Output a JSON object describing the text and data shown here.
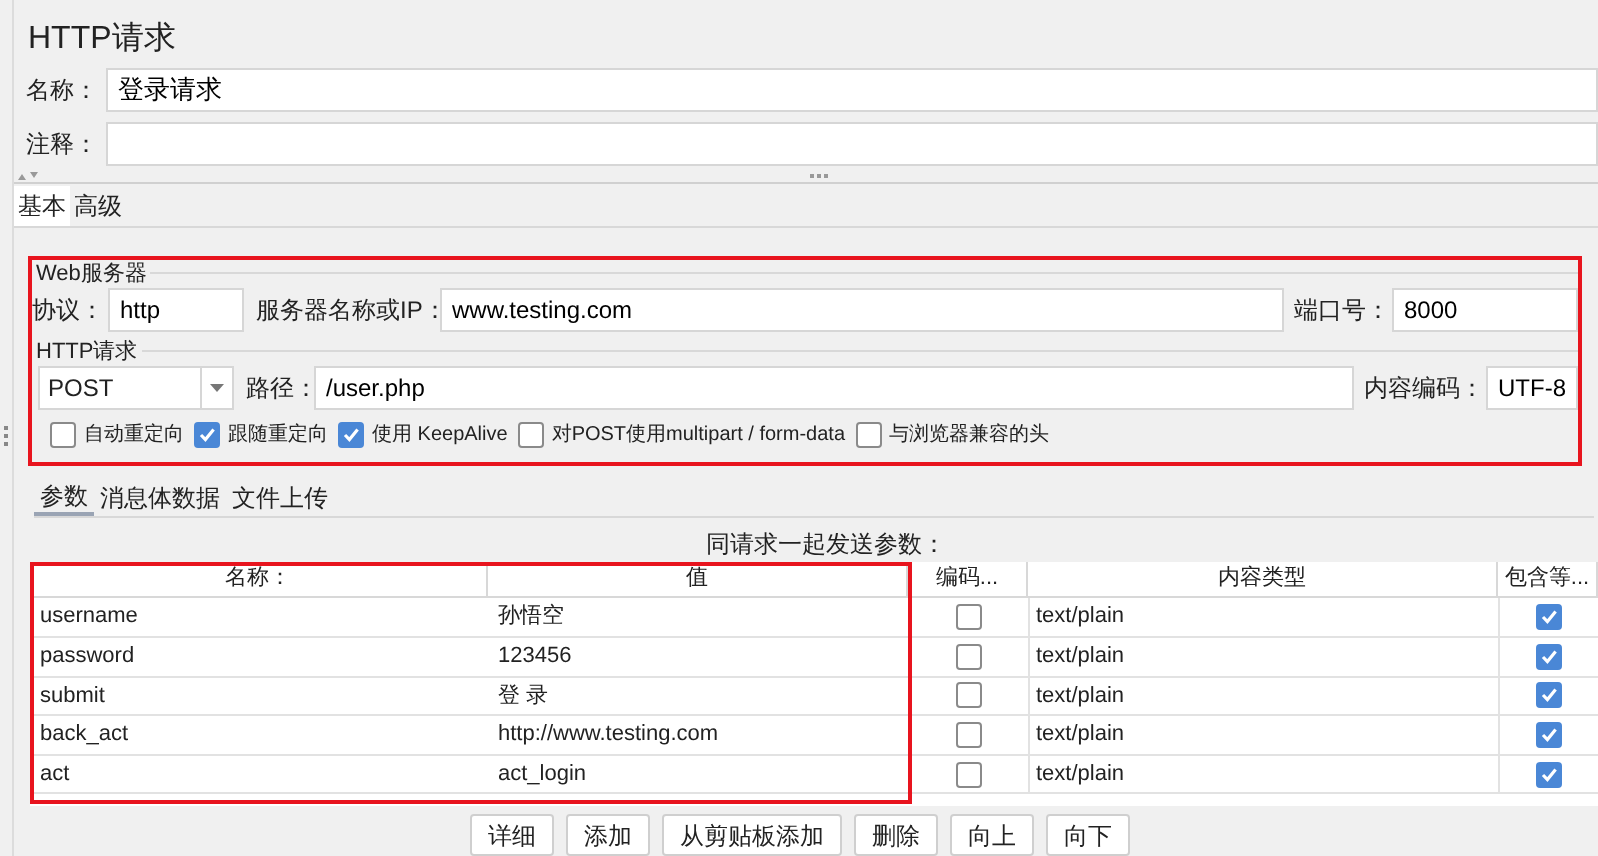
{
  "title": "HTTP请求",
  "name_field": {
    "label": "名称：",
    "value": "登录请求"
  },
  "comment_field": {
    "label": "注释："
  },
  "tabs": [
    {
      "label": "基本",
      "selected": true
    },
    {
      "label": "高级",
      "selected": false
    }
  ],
  "web_server": {
    "legend": "Web服务器",
    "protocol": {
      "label": "协议：",
      "value": "http"
    },
    "server": {
      "label": "服务器名称或IP：",
      "value": "www.testing.com"
    },
    "port": {
      "label": "端口号：",
      "value": "8000"
    }
  },
  "http_request": {
    "legend": "HTTP请求",
    "method": "POST",
    "path": {
      "label": "路径：",
      "value": "/user.php"
    },
    "encoding": {
      "label": "内容编码：",
      "value": "UTF-8"
    },
    "options": [
      {
        "label": "自动重定向",
        "checked": false
      },
      {
        "label": "跟随重定向",
        "checked": true
      },
      {
        "label": "使用 KeepAlive",
        "checked": true
      },
      {
        "label": "对POST使用multipart / form-data",
        "checked": false
      },
      {
        "label": "与浏览器兼容的头",
        "checked": false
      }
    ]
  },
  "param_tabs": [
    {
      "label": "参数",
      "selected": true
    },
    {
      "label": "消息体数据",
      "selected": false
    },
    {
      "label": "文件上传",
      "selected": false
    }
  ],
  "params_caption": "同请求一起发送参数：",
  "table": {
    "columns": [
      "名称：",
      "值",
      "编码...",
      "内容类型",
      "包含等..."
    ],
    "rows": [
      {
        "name": "username",
        "value": "孙悟空",
        "encode": false,
        "content_type": "text/plain",
        "include_equals": true
      },
      {
        "name": "password",
        "value": "123456",
        "encode": false,
        "content_type": "text/plain",
        "include_equals": true
      },
      {
        "name": "submit",
        "value": "登 录",
        "encode": false,
        "content_type": "text/plain",
        "include_equals": true
      },
      {
        "name": "back_act",
        "value": "http://www.testing.com",
        "encode": false,
        "content_type": "text/plain",
        "include_equals": true
      },
      {
        "name": "act",
        "value": "act_login",
        "encode": false,
        "content_type": "text/plain",
        "include_equals": true
      }
    ]
  },
  "buttons": [
    "详细",
    "添加",
    "从剪贴板添加",
    "删除",
    "向上",
    "向下"
  ]
}
